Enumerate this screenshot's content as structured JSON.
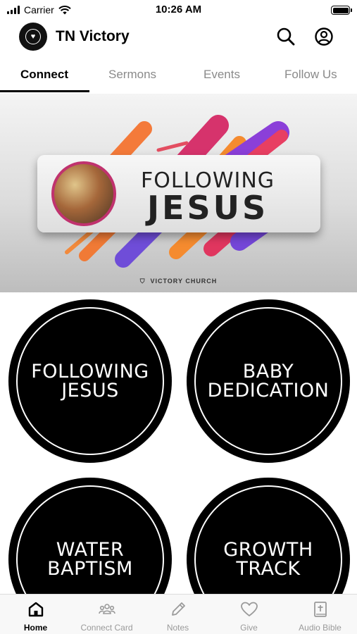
{
  "status_bar": {
    "carrier": "Carrier",
    "time": "10:26 AM"
  },
  "header": {
    "title": "TN Victory",
    "logo_icon": "church-logo-icon"
  },
  "tabs": [
    {
      "label": "Connect",
      "active": true
    },
    {
      "label": "Sermons",
      "active": false
    },
    {
      "label": "Events",
      "active": false
    },
    {
      "label": "Follow Us",
      "active": false
    }
  ],
  "banner": {
    "title_line1": "FOLLOWING",
    "title_line2": "JESUS",
    "footer": "VICTORY CHURCH"
  },
  "tiles": [
    {
      "label": "FOLLOWING\nJESUS"
    },
    {
      "label": "BABY\nDEDICATION"
    },
    {
      "label": "WATER\nBAPTISM"
    },
    {
      "label": "GROWTH\nTRACK"
    }
  ],
  "bottom_nav": [
    {
      "label": "Home",
      "icon": "home-icon",
      "active": true
    },
    {
      "label": "Connect Card",
      "icon": "people-icon",
      "active": false
    },
    {
      "label": "Notes",
      "icon": "pencil-icon",
      "active": false
    },
    {
      "label": "Give",
      "icon": "heart-icon",
      "active": false
    },
    {
      "label": "Audio Bible",
      "icon": "bible-icon",
      "active": false
    }
  ],
  "colors": {
    "accent": "#000000",
    "inactive": "#9a9a9a",
    "banner_ring": "#c0326e"
  }
}
